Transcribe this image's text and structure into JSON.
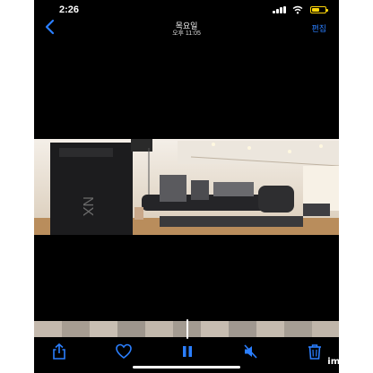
{
  "status": {
    "time": "2:26"
  },
  "nav": {
    "title": "목요일",
    "subtitle": "오후 11:05",
    "edit_label": "편집"
  },
  "colors": {
    "accent": "#2b7fff",
    "battery": "#ffd60a",
    "background": "#000000"
  },
  "icons": {
    "back": "chevron-left-icon",
    "share": "share-icon",
    "favorite": "heart-icon",
    "playback": "pause-icon",
    "mute": "speaker-muted-icon",
    "delete": "trash-icon"
  },
  "watermark": {
    "text": "imgPlay"
  }
}
